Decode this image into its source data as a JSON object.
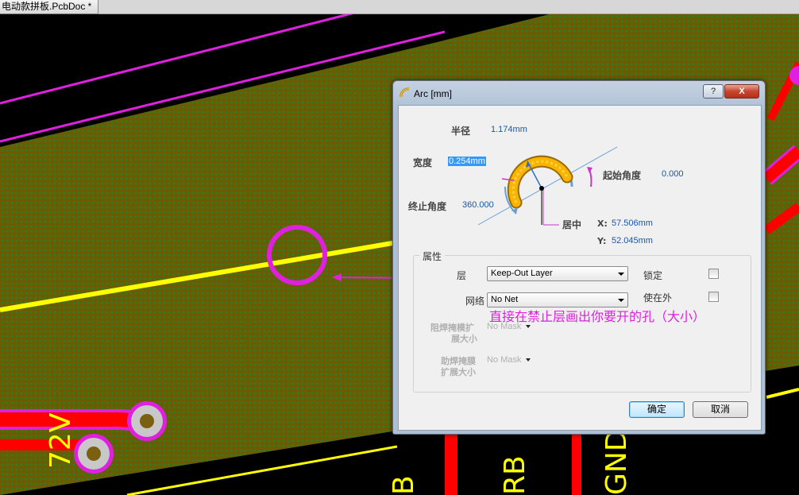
{
  "window": {
    "tab_title": "电动款拼板.PcbDoc *"
  },
  "dialog": {
    "title": "Arc [mm]",
    "help_label": "?",
    "close_label": "X",
    "radius_label": "半径",
    "radius_value": "1.174mm",
    "width_label": "宽度",
    "width_value": "0.254mm",
    "start_angle_label": "起始角度",
    "start_angle_value": "0.000",
    "end_angle_label": "终止角度",
    "end_angle_value": "360.000",
    "center_label": "居中",
    "x_label": "X:",
    "x_value": "57.506mm",
    "y_label": "Y:",
    "y_value": "52.045mm",
    "properties_title": "属性",
    "layer_label": "层",
    "layer_value": "Keep-Out Layer",
    "net_label": "网络",
    "net_value": "No Net",
    "lock_label": "锁定",
    "use_outside_label": "使在外",
    "solder_mask_label_1": "阻焊掩模扩",
    "solder_mask_label_2": "展大小",
    "solder_mask_value": "No Mask",
    "paste_mask_label_1": "助焊掩膜",
    "paste_mask_label_2": "扩展大小",
    "paste_mask_value": "No Mask",
    "ok_label": "确定",
    "cancel_label": "取消"
  },
  "annotation": {
    "text": "直接在禁止层画出你要开的孔（大小）",
    "color": "#e020e0"
  },
  "pcb": {
    "silk_labels": [
      "72V",
      "B",
      "RB",
      "GND"
    ],
    "colors": {
      "board": "#6e5a00",
      "dots": "#2f7d22",
      "keepout": "#ffff00",
      "track": "#ff0000",
      "outline": "#e020e0"
    }
  }
}
